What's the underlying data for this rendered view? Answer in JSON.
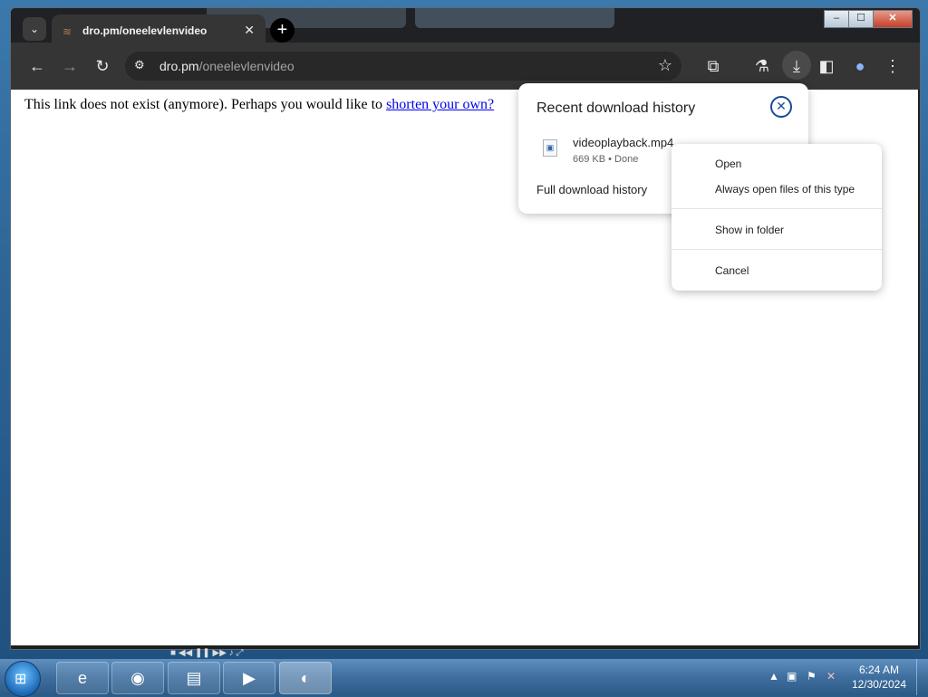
{
  "window": {
    "minimize": "–",
    "maximize": "☐",
    "close": "✕"
  },
  "tabs": {
    "search": "⌄",
    "active_title": "dro.pm/oneelevlenvideo",
    "close": "✕",
    "new_tab": "+"
  },
  "toolbar": {
    "back": "←",
    "forward": "→",
    "reload": "↻",
    "url_host": "dro.pm",
    "url_path": "/oneelevlenvideo",
    "site_info": "⚙",
    "bookmark": "☆",
    "extensions": "⧉",
    "labs": "⚗",
    "download": "⤓",
    "side_panel": "◧",
    "profile": "●",
    "menu": "⋮"
  },
  "page": {
    "message": "This link does not exist (anymore). Perhaps you would like to ",
    "link_text": "shorten your own?"
  },
  "downloads": {
    "title": "Recent download history",
    "close": "✕",
    "file_name": "videoplayback.mp4",
    "file_meta": "669 KB • Done",
    "full_history": "Full download history"
  },
  "context_menu": {
    "open": "Open",
    "always_open": "Always open files of this type",
    "show_in_folder": "Show in folder",
    "cancel": "Cancel"
  },
  "taskbar": {
    "start": "⊞",
    "apps": [
      {
        "name": "internet-explorer",
        "glyph": "e"
      },
      {
        "name": "firefox",
        "glyph": "◉"
      },
      {
        "name": "file-explorer",
        "glyph": "▤"
      },
      {
        "name": "media-player",
        "glyph": "▶"
      },
      {
        "name": "active-app",
        "glyph": "◐"
      }
    ],
    "time": "6:24 AM",
    "date": "12/30/2024"
  }
}
